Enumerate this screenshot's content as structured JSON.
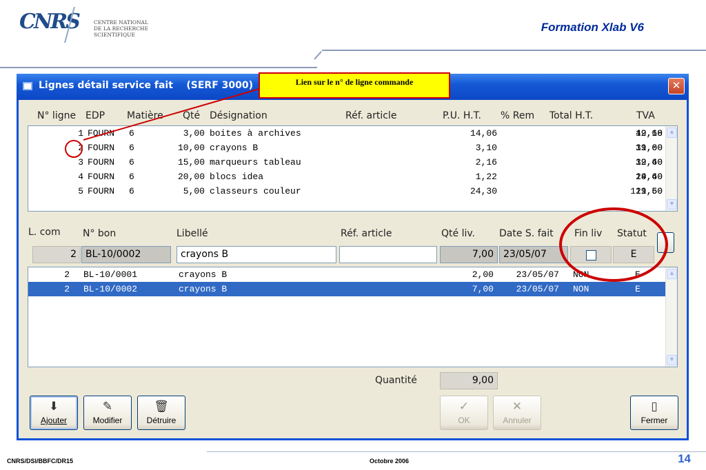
{
  "slide": {
    "title": "Formation Xlab V6",
    "logo_text": [
      "CENTRE NATIONAL",
      "DE LA RECHERCHE",
      "SCIENTIFIQUE"
    ],
    "logo_mark": "CNRS",
    "footer_left": "CNRS/DSI/BBFC/DR15",
    "footer_center": "Octobre 2006",
    "page_number": "14",
    "callout": "Lien sur le n° de ligne commande"
  },
  "window": {
    "title": "Lignes détail service fait    (SERF 3000)",
    "close": "✕"
  },
  "top_grid": {
    "headers": [
      "N° ligne",
      "EDP",
      "Matière",
      "Qté",
      "Désignation",
      "Réf. article",
      "P.U. H.T.",
      "% Rem",
      "Total H.T.",
      "TVA"
    ],
    "rows": [
      [
        "1",
        "FOURN",
        "6",
        "3,00",
        "boites à archives",
        "",
        "14,06",
        "",
        "42,18",
        "19,60"
      ],
      [
        "2",
        "FOURN",
        "6",
        "10,00",
        "crayons B",
        "",
        "3,10",
        "",
        "31,00",
        "19,60"
      ],
      [
        "3",
        "FOURN",
        "6",
        "15,00",
        "marqueurs tableau",
        "",
        "2,16",
        "",
        "32,40",
        "19,60"
      ],
      [
        "4",
        "FOURN",
        "6",
        "20,00",
        "blocs idea",
        "",
        "1,22",
        "",
        "24,40",
        "19,60"
      ],
      [
        "5",
        "FOURN",
        "6",
        "5,00",
        "classeurs couleur",
        "",
        "24,30",
        "",
        "121,50",
        "19,60"
      ]
    ]
  },
  "bottom": {
    "headers": [
      "L. com",
      "N° bon",
      "Libellé",
      "Réf. article",
      "Qté liv.",
      "Date S. fait",
      "Fin liv",
      "Statut"
    ],
    "edit_row": {
      "l_com": "2",
      "n_bon": "BL-10/0002",
      "libelle": "crayons B",
      "ref_article": "",
      "qte_liv": "7,00",
      "date": "23/05/07",
      "statut": "E"
    },
    "rows": [
      [
        "2",
        "BL-10/0001",
        "crayons B",
        "",
        "2,00",
        "23/05/07",
        "NON",
        "E"
      ],
      [
        "2",
        "BL-10/0002",
        "crayons B",
        "",
        "7,00",
        "23/05/07",
        "NON",
        "E"
      ]
    ],
    "quantite_label": "Quantité",
    "quantite_value": "9,00"
  },
  "buttons": {
    "ajouter": "Ajouter",
    "modifier": "Modifier",
    "detruire": "Détruire",
    "ok": "OK",
    "annuler": "Annuler",
    "fermer": "Fermer"
  },
  "colors": {
    "titlebar": "#0c48c7",
    "selection": "#316ac5",
    "highlight": "#cc0000",
    "callout": "#ffff00"
  }
}
